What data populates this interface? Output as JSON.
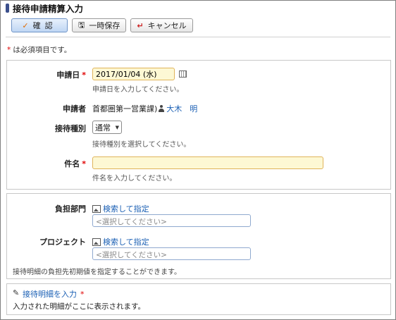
{
  "header": {
    "title": "接待申請精算入力"
  },
  "toolbar": {
    "confirm_label": "確認",
    "save_label": "一時保存",
    "cancel_label": "キャンセル"
  },
  "required_note": {
    "asterisk": "*",
    "text": "は必須項目です。"
  },
  "form": {
    "application_date": {
      "label": "申請日",
      "required": "*",
      "value": "2017/01/04 (水)",
      "hint": "申請日を入力してください。"
    },
    "applicant": {
      "label": "申請者",
      "department": "首都圏第一営業課)",
      "name": "大木　明"
    },
    "entertainment_type": {
      "label": "接待種別",
      "value": "通常",
      "hint": "接待種別を選択してください。"
    },
    "subject": {
      "label": "件名",
      "required": "*",
      "value": "",
      "hint": "件名を入力してください。"
    }
  },
  "allocation": {
    "department": {
      "label": "負担部門",
      "search_link": "検索して指定",
      "placeholder": "<選択してください>"
    },
    "project": {
      "label": "プロジェクト",
      "search_link": "検索して指定",
      "placeholder": "<選択してください>"
    },
    "note": "接待明細の負担先初期値を指定することができます。"
  },
  "details": {
    "link": "接待明細を入力",
    "required": "*",
    "note": "入力された明細がここに表示されます。"
  }
}
